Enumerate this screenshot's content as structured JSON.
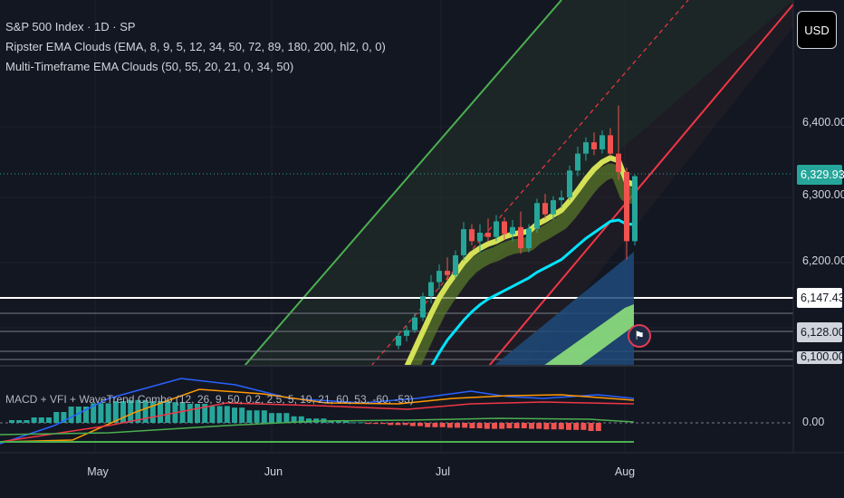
{
  "header": {
    "symbol_line": "S&P 500 Index · 1D · SP",
    "indicator_1": "Ripster EMA Clouds (EMA, 8, 9, 5, 12, 34, 50, 72, 89, 180, 200, hl2, 0, 0)",
    "indicator_2": "Multi-Timeframe EMA Clouds (50, 55, 20, 21, 0, 34, 50)",
    "indicator_3": "MACD + VFI + WaveTrend Combo (12, 26, 9, 50, 0.2, 2.5, 5, 10, 21, 60, 53, -60, -53)"
  },
  "currency_button": "USD",
  "price_axis": {
    "ticks": [
      "6,400.00",
      "6,300.00",
      "6,200.00",
      "6,128.00",
      "6,100.00"
    ],
    "last_price_tag": "6,329.93",
    "level_tag": "6,147.43",
    "osc_zero": "0.00"
  },
  "time_axis": [
    "May",
    "Jun",
    "Jul",
    "Aug"
  ],
  "colors": {
    "bg": "#131722",
    "up": "#26a69a",
    "down": "#ef5350",
    "channel_green": "#4caf50",
    "channel_red": "#f23645",
    "ema_fast": "#d4e157",
    "ema_slow": "#00e5ff",
    "cloud_blue": "#1e4a7a",
    "cloud_green": "#8ee07a"
  },
  "chart_data": {
    "type": "candlestick",
    "title": "S&P 500 Index · 1D · SP",
    "ylim": [
      6080,
      6560
    ],
    "levels": [
      6329.93,
      6147.43,
      6128.0,
      6100.0
    ],
    "candles": [
      {
        "o": 6090,
        "h": 6108,
        "l": 6085,
        "c": 6104
      },
      {
        "o": 6104,
        "h": 6118,
        "l": 6096,
        "c": 6112
      },
      {
        "o": 6112,
        "h": 6135,
        "l": 6108,
        "c": 6130
      },
      {
        "o": 6130,
        "h": 6165,
        "l": 6125,
        "c": 6160
      },
      {
        "o": 6160,
        "h": 6190,
        "l": 6150,
        "c": 6180
      },
      {
        "o": 6180,
        "h": 6205,
        "l": 6170,
        "c": 6196
      },
      {
        "o": 6196,
        "h": 6215,
        "l": 6182,
        "c": 6190
      },
      {
        "o": 6190,
        "h": 6225,
        "l": 6185,
        "c": 6218
      },
      {
        "o": 6218,
        "h": 6265,
        "l": 6210,
        "c": 6255
      },
      {
        "o": 6255,
        "h": 6262,
        "l": 6232,
        "c": 6238
      },
      {
        "o": 6238,
        "h": 6262,
        "l": 6222,
        "c": 6250
      },
      {
        "o": 6250,
        "h": 6270,
        "l": 6238,
        "c": 6244
      },
      {
        "o": 6244,
        "h": 6275,
        "l": 6238,
        "c": 6266
      },
      {
        "o": 6266,
        "h": 6272,
        "l": 6240,
        "c": 6248
      },
      {
        "o": 6248,
        "h": 6268,
        "l": 6238,
        "c": 6258
      },
      {
        "o": 6258,
        "h": 6280,
        "l": 6220,
        "c": 6228
      },
      {
        "o": 6228,
        "h": 6262,
        "l": 6222,
        "c": 6256
      },
      {
        "o": 6256,
        "h": 6298,
        "l": 6250,
        "c": 6292
      },
      {
        "o": 6292,
        "h": 6305,
        "l": 6270,
        "c": 6276
      },
      {
        "o": 6276,
        "h": 6302,
        "l": 6268,
        "c": 6296
      },
      {
        "o": 6296,
        "h": 6310,
        "l": 6285,
        "c": 6300
      },
      {
        "o": 6300,
        "h": 6345,
        "l": 6296,
        "c": 6338
      },
      {
        "o": 6338,
        "h": 6372,
        "l": 6330,
        "c": 6362
      },
      {
        "o": 6362,
        "h": 6385,
        "l": 6352,
        "c": 6378
      },
      {
        "o": 6378,
        "h": 6392,
        "l": 6360,
        "c": 6368
      },
      {
        "o": 6368,
        "h": 6395,
        "l": 6362,
        "c": 6388
      },
      {
        "o": 6388,
        "h": 6398,
        "l": 6358,
        "c": 6362
      },
      {
        "o": 6362,
        "h": 6430,
        "l": 6325,
        "c": 6336
      },
      {
        "o": 6336,
        "h": 6342,
        "l": 6212,
        "c": 6238
      },
      {
        "o": 6238,
        "h": 6332,
        "l": 6232,
        "c": 6330
      }
    ],
    "ema_fast": [
      6040,
      6060,
      6085,
      6110,
      6135,
      6158,
      6176,
      6192,
      6208,
      6220,
      6228,
      6234,
      6238,
      6244,
      6248,
      6250,
      6252,
      6262,
      6268,
      6275,
      6282,
      6295,
      6310,
      6326,
      6340,
      6350,
      6356,
      6352,
      6322,
      6318
    ],
    "ema_slow": [
      5990,
      6005,
      6020,
      6040,
      6060,
      6080,
      6098,
      6112,
      6126,
      6138,
      6148,
      6156,
      6162,
      6168,
      6174,
      6180,
      6186,
      6194,
      6200,
      6206,
      6212,
      6222,
      6232,
      6242,
      6250,
      6258,
      6266,
      6268,
      6262,
      6262
    ],
    "oscillator_histogram": [
      0.5,
      1.0,
      2.0,
      3.0,
      3.6,
      4.0,
      4.2,
      4.0,
      3.8,
      3.5,
      3.1,
      2.8,
      2.3,
      1.8,
      1.2,
      0.8,
      0.4,
      0.1,
      -0.2,
      -0.4,
      -0.6,
      -0.8,
      -0.9,
      -1.0,
      -1.1,
      -1.0,
      -1.1,
      -1.2,
      -1.3,
      -1.5
    ]
  }
}
